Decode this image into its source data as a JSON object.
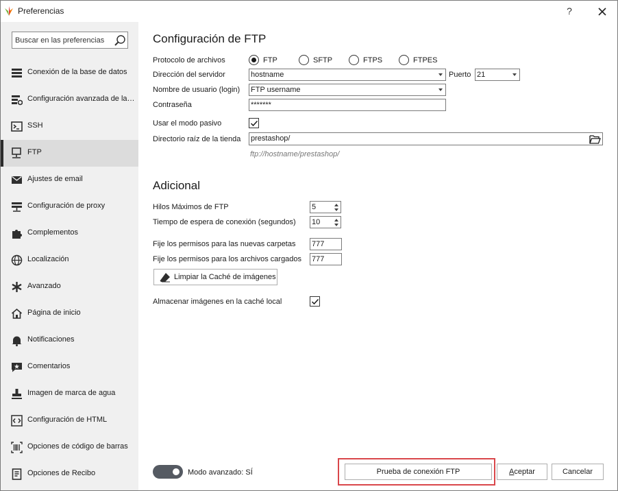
{
  "window": {
    "title": "Preferencias",
    "help_label": "?",
    "close_label": "close"
  },
  "sidebar": {
    "search_placeholder": "Buscar en las preferencias",
    "items": [
      {
        "label": "Conexión de la base de datos",
        "icon": "database-icon"
      },
      {
        "label": "Configuración avanzada de la base de datos",
        "icon": "database-settings-icon"
      },
      {
        "label": "SSH",
        "icon": "terminal-icon"
      },
      {
        "label": "FTP",
        "icon": "ftp-icon",
        "active": true
      },
      {
        "label": "Ajustes de email",
        "icon": "envelope-icon"
      },
      {
        "label": "Configuración de proxy",
        "icon": "proxy-icon"
      },
      {
        "label": "Complementos",
        "icon": "puzzle-icon"
      },
      {
        "label": "Localización",
        "icon": "globe-icon"
      },
      {
        "label": "Avanzado",
        "icon": "asterisk-icon"
      },
      {
        "label": "Página de inicio",
        "icon": "home-icon"
      },
      {
        "label": "Notificaciones",
        "icon": "bell-icon"
      },
      {
        "label": "Comentarios",
        "icon": "comment-star-icon"
      },
      {
        "label": "Imagen de marca de agua",
        "icon": "stamp-icon"
      },
      {
        "label": "Configuración de HTML",
        "icon": "html-icon"
      },
      {
        "label": "Opciones de código de barras",
        "icon": "barcode-icon"
      },
      {
        "label": "Opciones de Recibo",
        "icon": "receipt-icon"
      }
    ]
  },
  "ftp": {
    "section_title": "Configuración de FTP",
    "protocol_label": "Protocolo de archivos",
    "protocols": [
      "FTP",
      "SFTP",
      "FTPS",
      "FTPES"
    ],
    "selected_protocol": "FTP",
    "server_label": "Dirección del servidor",
    "server_value": "hostname",
    "port_label": "Puerto",
    "port_value": "21",
    "username_label": "Nombre de usuario (login)",
    "username_value": "FTP username",
    "password_label": "Contraseña",
    "password_value": "*******",
    "passive_label": "Usar el modo pasivo",
    "passive_checked": true,
    "root_label": "Directorio raíz de la tienda",
    "root_value": "prestashop/",
    "root_hint": "ftp://hostname/prestashop/"
  },
  "additional": {
    "section_title": "Adicional",
    "max_threads_label": "Hilos Máximos de FTP",
    "max_threads_value": "5",
    "timeout_label": "Tiempo de espera de conexión (segundos)",
    "timeout_value": "10",
    "folder_perm_label": "Fije los permisos para las nuevas carpetas",
    "folder_perm_value": "777",
    "file_perm_label": "Fije los permisos para los archivos cargados",
    "file_perm_value": "777",
    "clear_cache_label": "Limpiar la Caché de imágenes",
    "local_cache_label": "Almacenar imágenes en la caché local",
    "local_cache_checked": true
  },
  "footer": {
    "advanced_mode_label": "Modo avanzado: SÍ",
    "advanced_mode_on": true,
    "test_button": "Prueba de conexión FTP",
    "accept_button_first": "A",
    "accept_button_rest": "ceptar",
    "cancel_button": "Cancelar"
  },
  "colors": {
    "highlight": "#d9464a",
    "sidebar_bg": "#f0f0f0",
    "active_item_bg": "#dcdcdc",
    "toggle_bg": "#555a62"
  }
}
